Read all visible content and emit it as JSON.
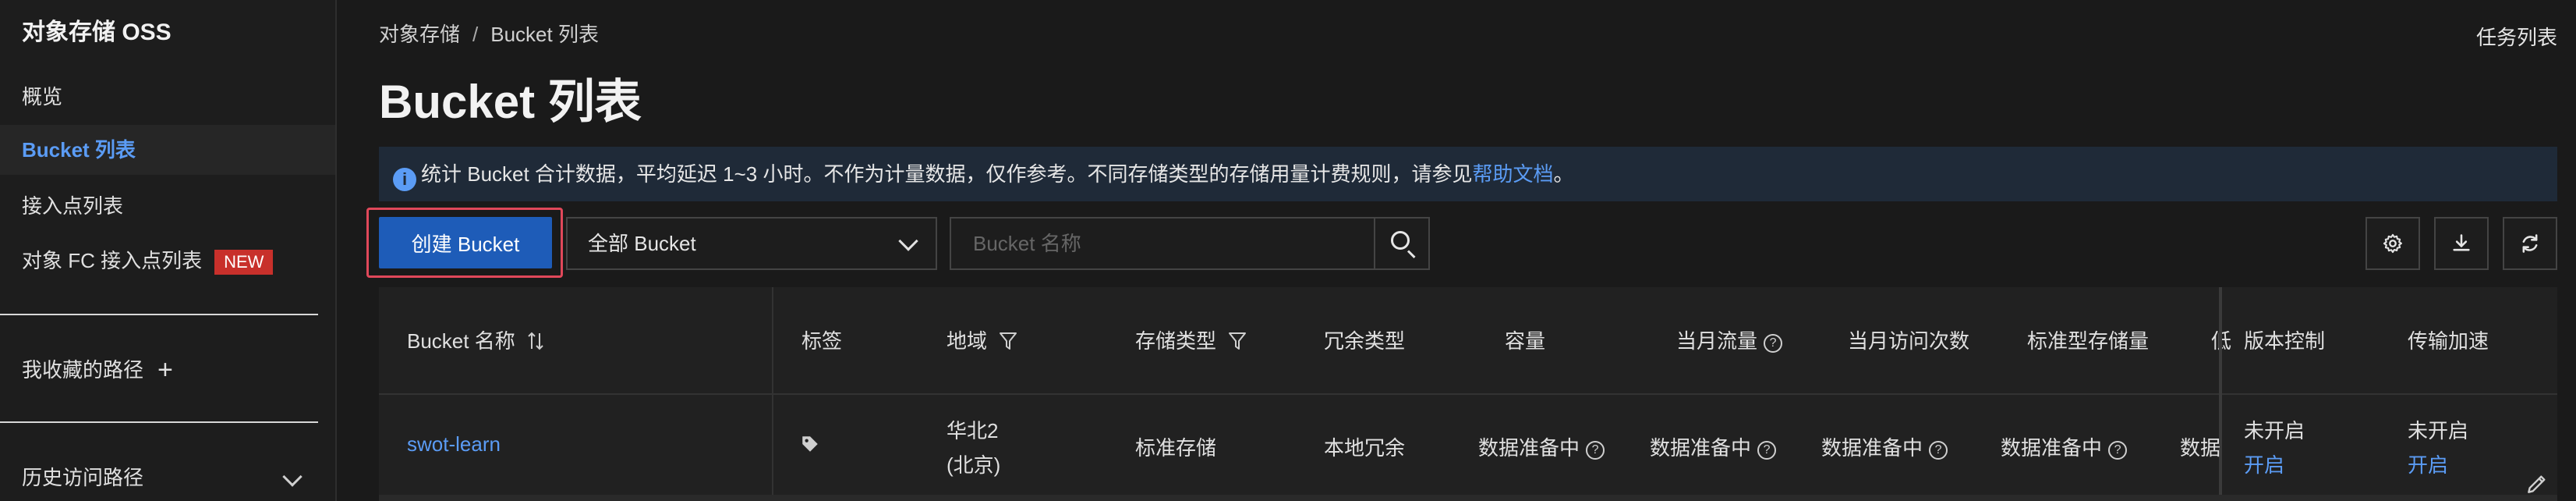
{
  "sidebar": {
    "title": "对象存储 OSS",
    "items": [
      {
        "label": "概览"
      },
      {
        "label": "Bucket 列表"
      },
      {
        "label": "接入点列表"
      },
      {
        "label": "对象 FC 接入点列表",
        "badge": "NEW"
      }
    ],
    "favorites_label": "我收藏的路径",
    "history_label": "历史访问路径"
  },
  "header": {
    "breadcrumb": [
      "对象存储",
      "Bucket 列表"
    ],
    "breadcrumb_sep": "/",
    "title": "Bucket 列表",
    "task_list": "任务列表"
  },
  "notice": {
    "text": "统计 Bucket 合计数据，平均延迟 1~3 小时。不作为计量数据，仅作参考。不同存储类型的存储用量计费规则，请参见",
    "link": "帮助文档",
    "suffix": "。"
  },
  "toolbar": {
    "create_label": "创建 Bucket",
    "filter_value": "全部 Bucket",
    "search_placeholder": "Bucket 名称"
  },
  "table": {
    "columns": {
      "name": "Bucket 名称",
      "tags": "标签",
      "region": "地域",
      "storage_class": "存储类型",
      "redundancy": "冗余类型",
      "capacity": "容量",
      "monthly_traffic": "当月流量",
      "monthly_visits": "当月访问次数",
      "standard_storage": "标准型存储量",
      "truncated": "低",
      "versioning": "版本控制",
      "acceleration": "传输加速"
    },
    "rows": [
      {
        "name": "swot-learn",
        "region_line1": "华北2",
        "region_line2": "(北京)",
        "storage_class": "标准存储",
        "redundancy": "本地冗余",
        "capacity": "数据准备中",
        "monthly_traffic": "数据准备中",
        "monthly_visits": "数据准备中",
        "standard_storage": "数据准备中",
        "truncated": "数据",
        "versioning_status": "未开启",
        "versioning_action": "开启",
        "acceleration_status": "未开启",
        "acceleration_action": "开启"
      }
    ]
  },
  "colors": {
    "accent": "#5b9cf5",
    "primary_button": "#1e5cb8",
    "highlight_border": "#e0485a",
    "new_badge": "#c8302b"
  }
}
